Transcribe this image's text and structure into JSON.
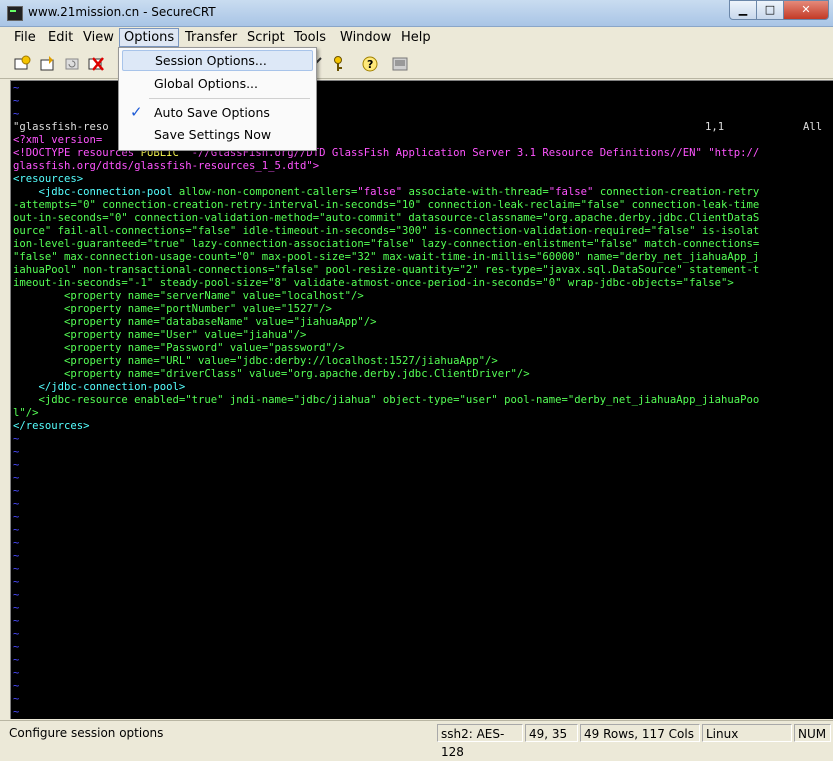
{
  "window": {
    "title": "www.21mission.cn - SecureCRT"
  },
  "menubar": {
    "items": [
      "File",
      "Edit",
      "View",
      "Options",
      "Transfer",
      "Script",
      "Tools",
      "Window",
      "Help"
    ]
  },
  "options_menu": {
    "session_options": "Session Options...",
    "global_options": "Global Options...",
    "auto_save": "Auto Save Options",
    "auto_save_checked": "✓",
    "save_now": "Save Settings Now"
  },
  "terminal": {
    "l3a": "\"glassfish-reso",
    "l3b": "1,1",
    "l3c": "All",
    "l4": "<?xml version=",
    "l5a": "<!DOCTYPE resources ",
    "l5b": "PUBLIC ",
    "l5c": "\"-//GlassFish.org//DTD GlassFish Application Server 3.1 Resource Definitions//EN\" \"http://",
    "l6": "glassfish.org/dtds/glassfish-resources_1_5.dtd\">",
    "l7": "<resources>",
    "l8a": "    <jdbc-connection-pool ",
    "l8b": "allow-non-component-callers=",
    "l8c": "\"false\"",
    "l8d": " associate-with-thread=",
    "l8e": "\"false\"",
    "l8f": " connection-creation-retry",
    "l9": "-attempts=\"0\" connection-creation-retry-interval-in-seconds=\"10\" connection-leak-reclaim=\"false\" connection-leak-time",
    "l10": "out-in-seconds=\"0\" connection-validation-method=\"auto-commit\" datasource-classname=\"org.apache.derby.jdbc.ClientDataS",
    "l11": "ource\" fail-all-connections=\"false\" idle-timeout-in-seconds=\"300\" is-connection-validation-required=\"false\" is-isolat",
    "l12": "ion-level-guaranteed=\"true\" lazy-connection-association=\"false\" lazy-connection-enlistment=\"false\" match-connections=",
    "l13": "\"false\" max-connection-usage-count=\"0\" max-pool-size=\"32\" max-wait-time-in-millis=\"60000\" name=\"derby_net_jiahuaApp_j",
    "l14": "iahuaPool\" non-transactional-connections=\"false\" pool-resize-quantity=\"2\" res-type=\"javax.sql.DataSource\" statement-t",
    "l15": "imeout-in-seconds=\"-1\" steady-pool-size=\"8\" validate-atmost-once-period-in-seconds=\"0\" wrap-jdbc-objects=\"false\">",
    "p1": "        <property name=\"serverName\" value=\"localhost\"/>",
    "p2": "        <property name=\"portNumber\" value=\"1527\"/>",
    "p3": "        <property name=\"databaseName\" value=\"jiahuaApp\"/>",
    "p4": "        <property name=\"User\" value=\"jiahua\"/>",
    "p5": "        <property name=\"Password\" value=\"password\"/>",
    "p6": "        <property name=\"URL\" value=\"jdbc:derby://localhost:1527/jiahuaApp\"/>",
    "p7": "        <property name=\"driverClass\" value=\"org.apache.derby.jdbc.ClientDriver\"/>",
    "l23": "    </jdbc-connection-pool>",
    "l24": "    <jdbc-resource enabled=\"true\" jndi-name=\"jdbc/jiahua\" object-type=\"user\" pool-name=\"derby_net_jiahuaApp_jiahuaPoo",
    "l25": "l\"/>",
    "l26": "</resources>",
    "tilde": "~"
  },
  "statusbar": {
    "message": "Configure session options",
    "protocol": "ssh2: AES-128",
    "cursor": "49,  35",
    "size": "49 Rows, 117 Cols",
    "os": "Linux",
    "num": "NUM"
  }
}
